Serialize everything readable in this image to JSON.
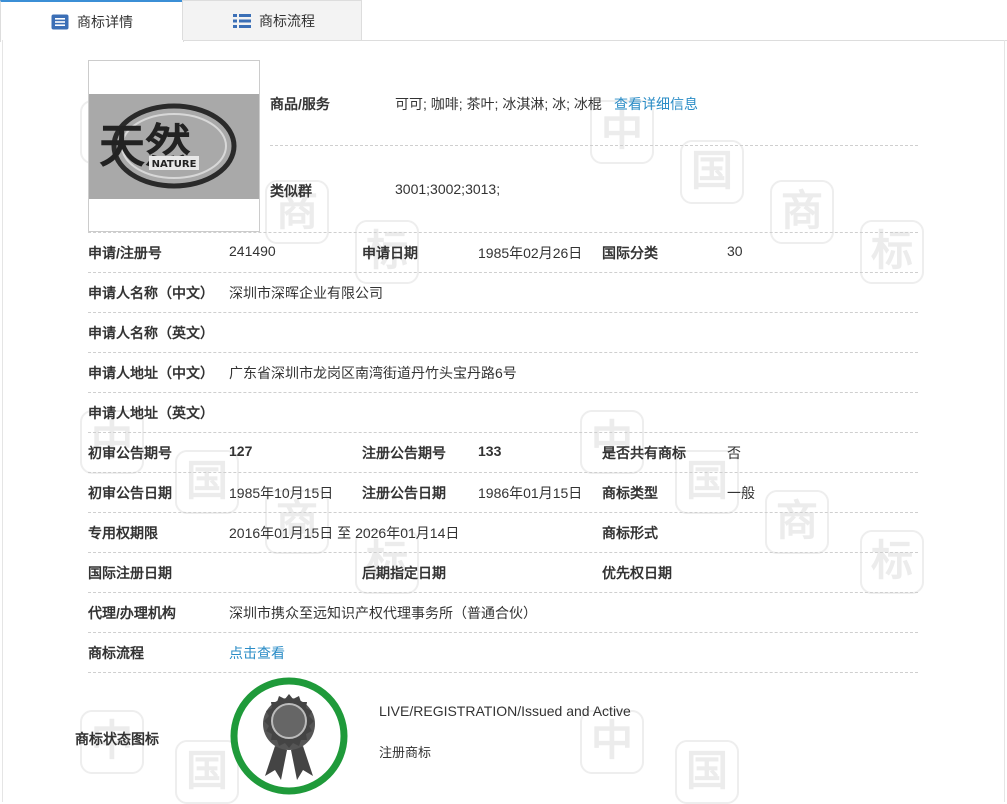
{
  "tabs": [
    {
      "label": "商标详情"
    },
    {
      "label": "商标流程"
    }
  ],
  "logo": {
    "text": "天然",
    "subtext": "NATURE"
  },
  "goods": {
    "label": "商品/服务",
    "value": "可可; 咖啡; 茶叶; 冰淇淋; 冰; 冰棍",
    "link": "查看详细信息"
  },
  "similar": {
    "label": "类似群",
    "value": "3001;3002;3013;"
  },
  "rows": {
    "reg_no": {
      "label": "申请/注册号",
      "value": "241490"
    },
    "apply_date": {
      "label": "申请日期",
      "value": "1985年02月26日"
    },
    "intl_class": {
      "label": "国际分类",
      "value": "30"
    },
    "name_cn": {
      "label": "申请人名称（中文）",
      "value": "深圳市深晖企业有限公司"
    },
    "name_en": {
      "label": "申请人名称（英文）",
      "value": ""
    },
    "addr_cn": {
      "label": "申请人地址（中文）",
      "value": "广东省深圳市龙岗区南湾街道丹竹头宝丹路6号"
    },
    "addr_en": {
      "label": "申请人地址（英文）",
      "value": ""
    },
    "prelim_no": {
      "label": "初审公告期号",
      "value": "127"
    },
    "reg_pub_no": {
      "label": "注册公告期号",
      "value": "133"
    },
    "shared": {
      "label": "是否共有商标",
      "value": "否"
    },
    "prelim_date": {
      "label": "初审公告日期",
      "value": "1985年10月15日"
    },
    "reg_pub_date": {
      "label": "注册公告日期",
      "value": "1986年01月15日"
    },
    "tm_type": {
      "label": "商标类型",
      "value": "一般"
    },
    "excl_period": {
      "label": "专用权期限",
      "value": "2016年01月15日 至 2026年01月14日"
    },
    "tm_form": {
      "label": "商标形式",
      "value": ""
    },
    "intl_reg_date": {
      "label": "国际注册日期",
      "value": ""
    },
    "later_date": {
      "label": "后期指定日期",
      "value": ""
    },
    "priority_date": {
      "label": "优先权日期",
      "value": ""
    },
    "agent": {
      "label": "代理/办理机构",
      "value": "深圳市携众至远知识产权代理事务所（普通合伙）"
    },
    "process": {
      "label": "商标流程",
      "link": "点击查看"
    }
  },
  "status": {
    "label": "商标状态图标",
    "line1": "LIVE/REGISTRATION/Issued and Active",
    "line2": "注册商标",
    "ring_color": "#1f9a3a"
  },
  "watermark": [
    "中",
    "国",
    "商",
    "标"
  ]
}
